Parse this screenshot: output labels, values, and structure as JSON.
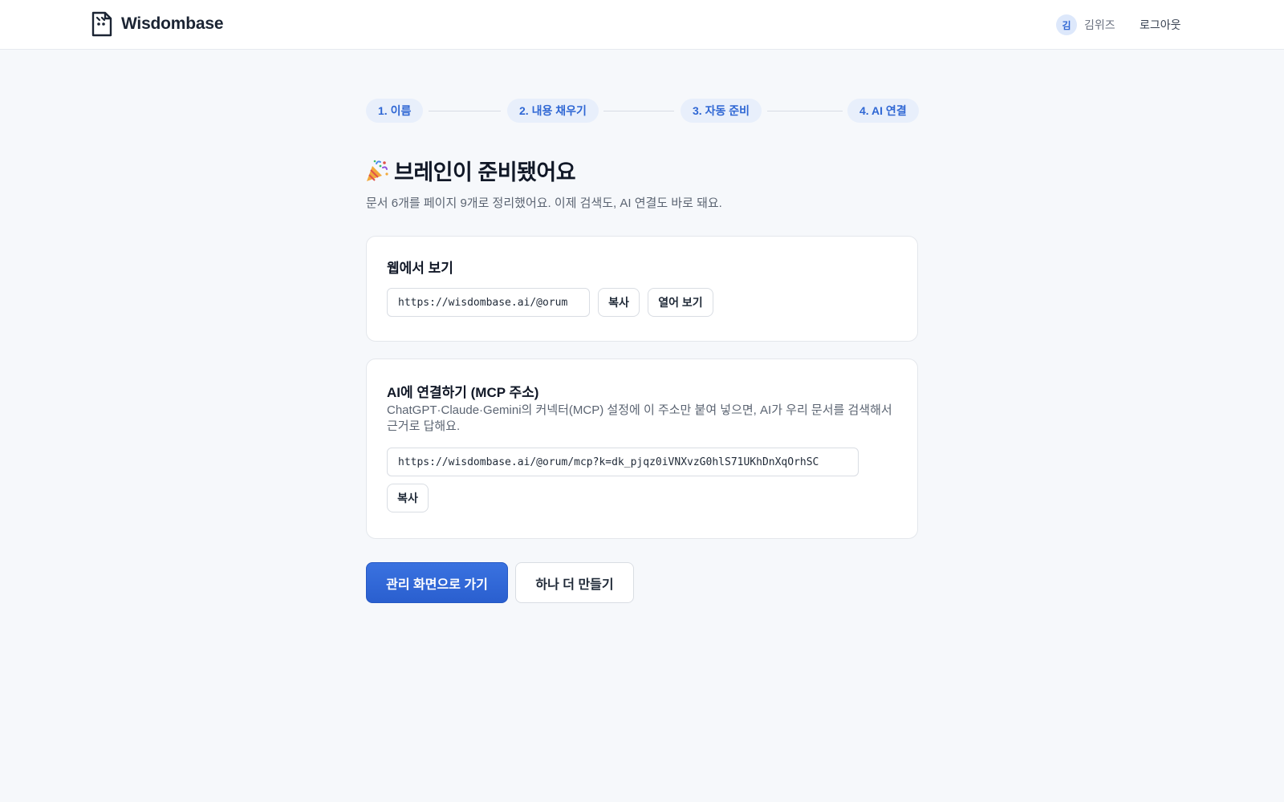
{
  "header": {
    "brand": "Wisdombase",
    "logo_icon": "book-logo-icon",
    "user": {
      "initial": "김",
      "name": "김위즈"
    },
    "logout_label": "로그아웃"
  },
  "steps": [
    {
      "label": "1. 이름"
    },
    {
      "label": "2. 내용 채우기"
    },
    {
      "label": "3. 자동 준비"
    },
    {
      "label": "4. AI 연결"
    }
  ],
  "main": {
    "emoji_icon": "party-popper-icon",
    "title": "브레인이 준비됐어요",
    "subtitle": "문서 6개를 페이지 9개로 정리했어요. 이제 검색도, AI 연결도 바로 돼요."
  },
  "web_card": {
    "title": "웹에서 보기",
    "url": "https://wisdombase.ai/@orum",
    "copy_label": "복사",
    "open_label": "열어 보기"
  },
  "mcp_card": {
    "title": "AI에 연결하기 (MCP 주소)",
    "description": "ChatGPT·Claude·Gemini의 커넥터(MCP) 설정에 이 주소만 붙여 넣으면, AI가 우리 문서를 검색해서 근거로 답해요.",
    "url": "https://wisdombase.ai/@orum/mcp?k=dk_pjqz0iVNXvzG0hlS71UKhDnXqOrhSC",
    "copy_label": "복사"
  },
  "actions": {
    "primary_label": "관리 화면으로 가기",
    "secondary_label": "하나 더 만들기"
  },
  "colors": {
    "accent": "#2f67d4",
    "step_bg": "#e8effb",
    "background": "#f6f8fb"
  }
}
